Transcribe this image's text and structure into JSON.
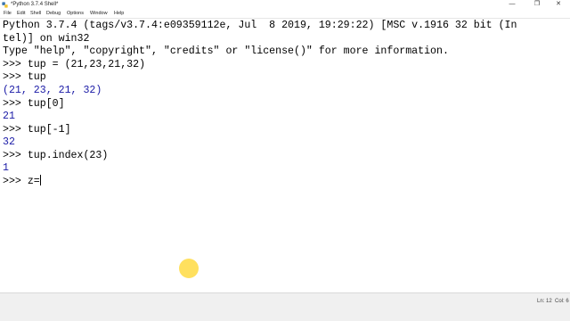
{
  "window": {
    "title": "*Python 3.7.4 Shell*",
    "controls": {
      "minimize": "—",
      "maximize": "❐",
      "close": "✕"
    }
  },
  "menu": {
    "items": [
      "File",
      "Edit",
      "Shell",
      "Debug",
      "Options",
      "Window",
      "Help"
    ]
  },
  "shell": {
    "lines": [
      {
        "type": "banner",
        "text": "Python 3.7.4 (tags/v3.7.4:e09359112e, Jul  8 2019, 19:29:22) [MSC v.1916 32 bit (In"
      },
      {
        "type": "banner",
        "text": "tel)] on win32"
      },
      {
        "type": "banner",
        "text": "Type \"help\", \"copyright\", \"credits\" or \"license()\" for more information."
      },
      {
        "type": "input",
        "prompt": ">>> ",
        "text": "tup = (21,23,21,32)"
      },
      {
        "type": "input",
        "prompt": ">>> ",
        "text": "tup"
      },
      {
        "type": "output",
        "text": "(21, 23, 21, 32)"
      },
      {
        "type": "input",
        "prompt": ">>> ",
        "text": "tup[0]"
      },
      {
        "type": "output",
        "text": "21"
      },
      {
        "type": "input",
        "prompt": ">>> ",
        "text": "tup[-1]"
      },
      {
        "type": "output",
        "text": "32"
      },
      {
        "type": "input",
        "prompt": ">>> ",
        "text": "tup.index(23)"
      },
      {
        "type": "output",
        "text": "1"
      },
      {
        "type": "input",
        "prompt": ">>> ",
        "text": "z="
      }
    ]
  },
  "status": {
    "ln": "Ln: 12",
    "col": "Col: 6"
  },
  "colors": {
    "output": "#1a1aa6",
    "prompt": "#000000",
    "highlight": "#ffd628"
  }
}
